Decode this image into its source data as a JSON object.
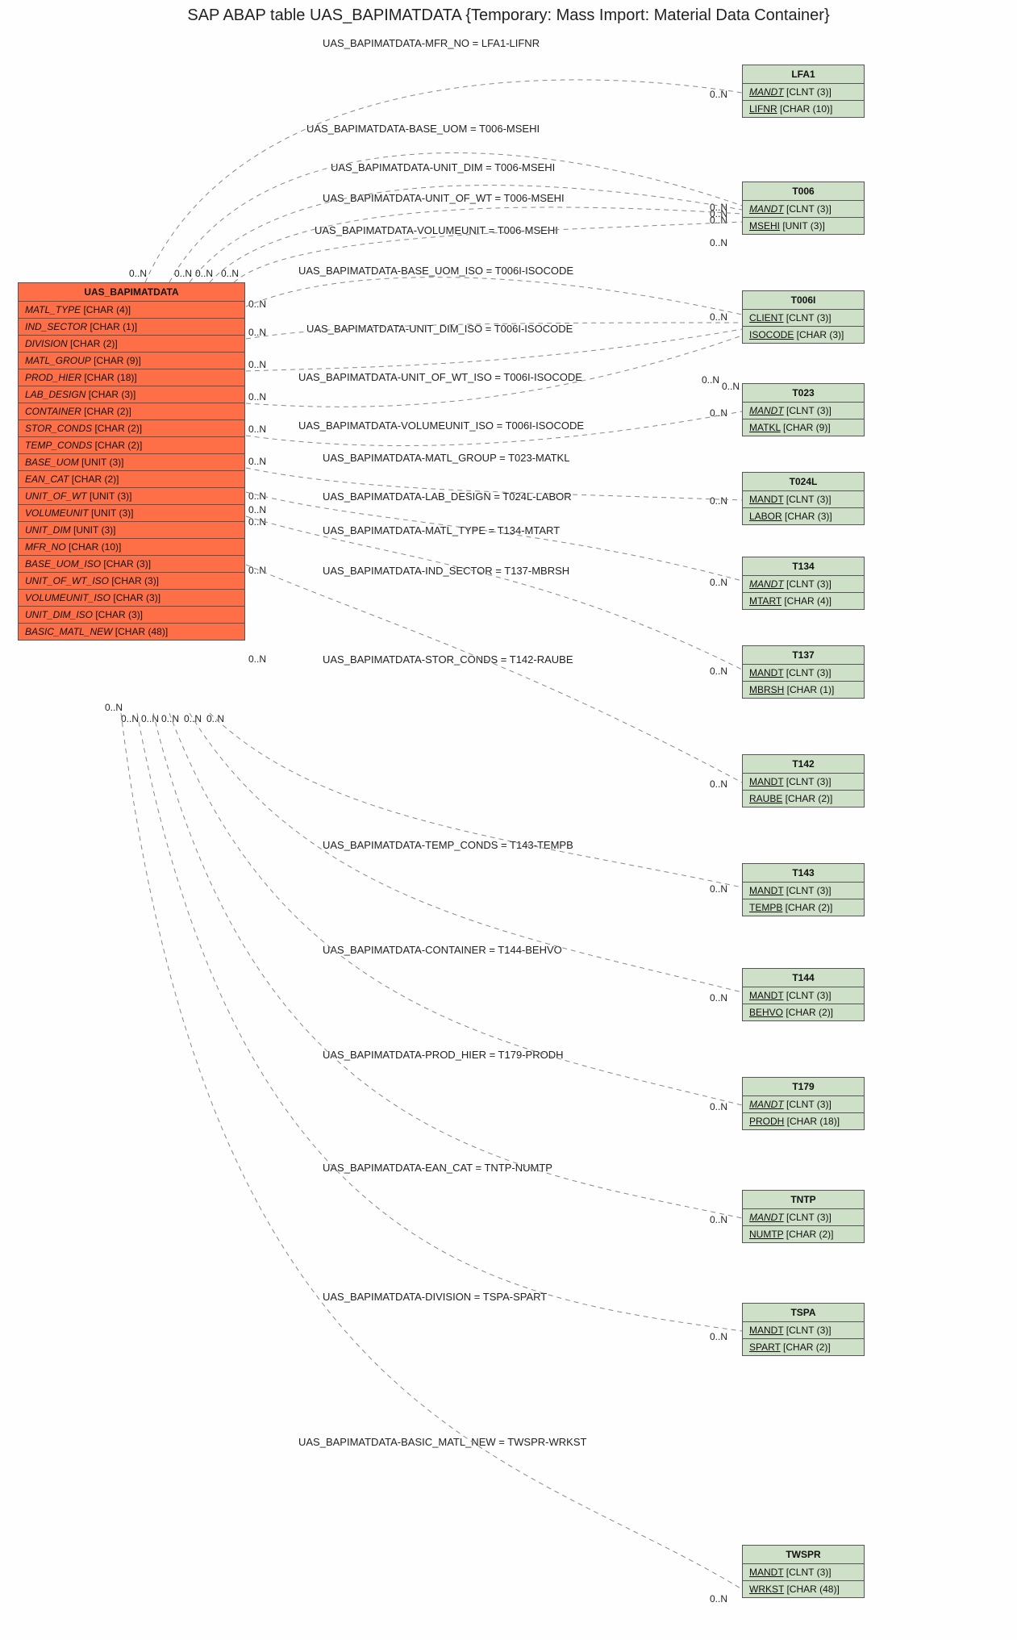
{
  "title": "SAP ABAP table UAS_BAPIMATDATA {Temporary: Mass Import: Material Data Container}",
  "source_table": {
    "name": "UAS_BAPIMATDATA",
    "fields": [
      {
        "name": "MATL_TYPE",
        "type": "CHAR (4)"
      },
      {
        "name": "IND_SECTOR",
        "type": "CHAR (1)"
      },
      {
        "name": "DIVISION",
        "type": "CHAR (2)"
      },
      {
        "name": "MATL_GROUP",
        "type": "CHAR (9)"
      },
      {
        "name": "PROD_HIER",
        "type": "CHAR (18)"
      },
      {
        "name": "LAB_DESIGN",
        "type": "CHAR (3)"
      },
      {
        "name": "CONTAINER",
        "type": "CHAR (2)"
      },
      {
        "name": "STOR_CONDS",
        "type": "CHAR (2)"
      },
      {
        "name": "TEMP_CONDS",
        "type": "CHAR (2)"
      },
      {
        "name": "BASE_UOM",
        "type": "UNIT (3)"
      },
      {
        "name": "EAN_CAT",
        "type": "CHAR (2)"
      },
      {
        "name": "UNIT_OF_WT",
        "type": "UNIT (3)"
      },
      {
        "name": "VOLUMEUNIT",
        "type": "UNIT (3)"
      },
      {
        "name": "UNIT_DIM",
        "type": "UNIT (3)"
      },
      {
        "name": "MFR_NO",
        "type": "CHAR (10)"
      },
      {
        "name": "BASE_UOM_ISO",
        "type": "CHAR (3)"
      },
      {
        "name": "UNIT_OF_WT_ISO",
        "type": "CHAR (3)"
      },
      {
        "name": "VOLUMEUNIT_ISO",
        "type": "CHAR (3)"
      },
      {
        "name": "UNIT_DIM_ISO",
        "type": "CHAR (3)"
      },
      {
        "name": "BASIC_MATL_NEW",
        "type": "CHAR (48)"
      }
    ]
  },
  "targets": [
    {
      "name": "LFA1",
      "fields": [
        {
          "name": "MANDT",
          "type": "CLNT (3)",
          "italic": true,
          "fk": true
        },
        {
          "name": "LIFNR",
          "type": "CHAR (10)",
          "italic": false,
          "fk": true
        }
      ]
    },
    {
      "name": "T006",
      "fields": [
        {
          "name": "MANDT",
          "type": "CLNT (3)",
          "italic": true,
          "fk": true
        },
        {
          "name": "MSEHI",
          "type": "UNIT (3)",
          "italic": false,
          "fk": true
        }
      ]
    },
    {
      "name": "T006I",
      "fields": [
        {
          "name": "CLIENT",
          "type": "CLNT (3)",
          "italic": false,
          "fk": true
        },
        {
          "name": "ISOCODE",
          "type": "CHAR (3)",
          "italic": false,
          "fk": true
        }
      ]
    },
    {
      "name": "T023",
      "fields": [
        {
          "name": "MANDT",
          "type": "CLNT (3)",
          "italic": true,
          "fk": true
        },
        {
          "name": "MATKL",
          "type": "CHAR (9)",
          "italic": false,
          "fk": true
        }
      ]
    },
    {
      "name": "T024L",
      "fields": [
        {
          "name": "MANDT",
          "type": "CLNT (3)",
          "italic": false,
          "fk": true
        },
        {
          "name": "LABOR",
          "type": "CHAR (3)",
          "italic": false,
          "fk": true
        }
      ]
    },
    {
      "name": "T134",
      "fields": [
        {
          "name": "MANDT",
          "type": "CLNT (3)",
          "italic": true,
          "fk": true
        },
        {
          "name": "MTART",
          "type": "CHAR (4)",
          "italic": false,
          "fk": true
        }
      ]
    },
    {
      "name": "T137",
      "fields": [
        {
          "name": "MANDT",
          "type": "CLNT (3)",
          "italic": false,
          "fk": true
        },
        {
          "name": "MBRSH",
          "type": "CHAR (1)",
          "italic": false,
          "fk": true
        }
      ]
    },
    {
      "name": "T142",
      "fields": [
        {
          "name": "MANDT",
          "type": "CLNT (3)",
          "italic": false,
          "fk": true
        },
        {
          "name": "RAUBE",
          "type": "CHAR (2)",
          "italic": false,
          "fk": true
        }
      ]
    },
    {
      "name": "T143",
      "fields": [
        {
          "name": "MANDT",
          "type": "CLNT (3)",
          "italic": false,
          "fk": true
        },
        {
          "name": "TEMPB",
          "type": "CHAR (2)",
          "italic": false,
          "fk": true
        }
      ]
    },
    {
      "name": "T144",
      "fields": [
        {
          "name": "MANDT",
          "type": "CLNT (3)",
          "italic": false,
          "fk": true
        },
        {
          "name": "BEHVO",
          "type": "CHAR (2)",
          "italic": false,
          "fk": true
        }
      ]
    },
    {
      "name": "T179",
      "fields": [
        {
          "name": "MANDT",
          "type": "CLNT (3)",
          "italic": true,
          "fk": true
        },
        {
          "name": "PRODH",
          "type": "CHAR (18)",
          "italic": false,
          "fk": true
        }
      ]
    },
    {
      "name": "TNTP",
      "fields": [
        {
          "name": "MANDT",
          "type": "CLNT (3)",
          "italic": true,
          "fk": true
        },
        {
          "name": "NUMTP",
          "type": "CHAR (2)",
          "italic": false,
          "fk": true
        }
      ]
    },
    {
      "name": "TSPA",
      "fields": [
        {
          "name": "MANDT",
          "type": "CLNT (3)",
          "italic": false,
          "fk": true
        },
        {
          "name": "SPART",
          "type": "CHAR (2)",
          "italic": false,
          "fk": true
        }
      ]
    },
    {
      "name": "TWSPR",
      "fields": [
        {
          "name": "MANDT",
          "type": "CLNT (3)",
          "italic": false,
          "fk": true
        },
        {
          "name": "WRKST",
          "type": "CHAR (48)",
          "italic": false,
          "fk": true
        }
      ]
    }
  ],
  "relationships": [
    {
      "label": "UAS_BAPIMATDATA-MFR_NO = LFA1-LIFNR"
    },
    {
      "label": "UAS_BAPIMATDATA-BASE_UOM = T006-MSEHI"
    },
    {
      "label": "UAS_BAPIMATDATA-UNIT_DIM = T006-MSEHI"
    },
    {
      "label": "UAS_BAPIMATDATA-UNIT_OF_WT = T006-MSEHI"
    },
    {
      "label": "UAS_BAPIMATDATA-VOLUMEUNIT = T006-MSEHI"
    },
    {
      "label": "UAS_BAPIMATDATA-BASE_UOM_ISO = T006I-ISOCODE"
    },
    {
      "label": "UAS_BAPIMATDATA-UNIT_DIM_ISO = T006I-ISOCODE"
    },
    {
      "label": "UAS_BAPIMATDATA-UNIT_OF_WT_ISO = T006I-ISOCODE"
    },
    {
      "label": "UAS_BAPIMATDATA-VOLUMEUNIT_ISO = T006I-ISOCODE"
    },
    {
      "label": "UAS_BAPIMATDATA-MATL_GROUP = T023-MATKL"
    },
    {
      "label": "UAS_BAPIMATDATA-LAB_DESIGN = T024L-LABOR"
    },
    {
      "label": "UAS_BAPIMATDATA-MATL_TYPE = T134-MTART"
    },
    {
      "label": "UAS_BAPIMATDATA-IND_SECTOR = T137-MBRSH"
    },
    {
      "label": "UAS_BAPIMATDATA-STOR_CONDS = T142-RAUBE"
    },
    {
      "label": "UAS_BAPIMATDATA-TEMP_CONDS = T143-TEMPB"
    },
    {
      "label": "UAS_BAPIMATDATA-CONTAINER = T144-BEHVO"
    },
    {
      "label": "UAS_BAPIMATDATA-PROD_HIER = T179-PRODH"
    },
    {
      "label": "UAS_BAPIMATDATA-EAN_CAT = TNTP-NUMTP"
    },
    {
      "label": "UAS_BAPIMATDATA-DIVISION = TSPA-SPART"
    },
    {
      "label": "UAS_BAPIMATDATA-BASIC_MATL_NEW = TWSPR-WRKST"
    }
  ],
  "cards": {
    "src_top": [
      "0..N",
      "0..N",
      "0..N",
      "0..N"
    ],
    "src_bot": [
      "0..N",
      "0..N",
      "0..N",
      "0..N",
      "0..N",
      "0..N"
    ],
    "src_right_top": "0..N",
    "mid_right": [
      "0..N",
      "0..N",
      "0..N",
      "0..N",
      "0..N",
      "0..N",
      "0..N",
      "0..N",
      "0..N",
      "0..N",
      "0..N"
    ],
    "tgt_left": [
      "0..N",
      "0..N",
      "0..N",
      "0..N",
      "0..N",
      "0..N",
      "0..N",
      "0..N",
      "0..N",
      "0..N",
      "0..N",
      "0..N",
      "0..N",
      "0..N",
      "0..N",
      "0..N",
      "0..N",
      "0..N",
      "0..N"
    ]
  }
}
